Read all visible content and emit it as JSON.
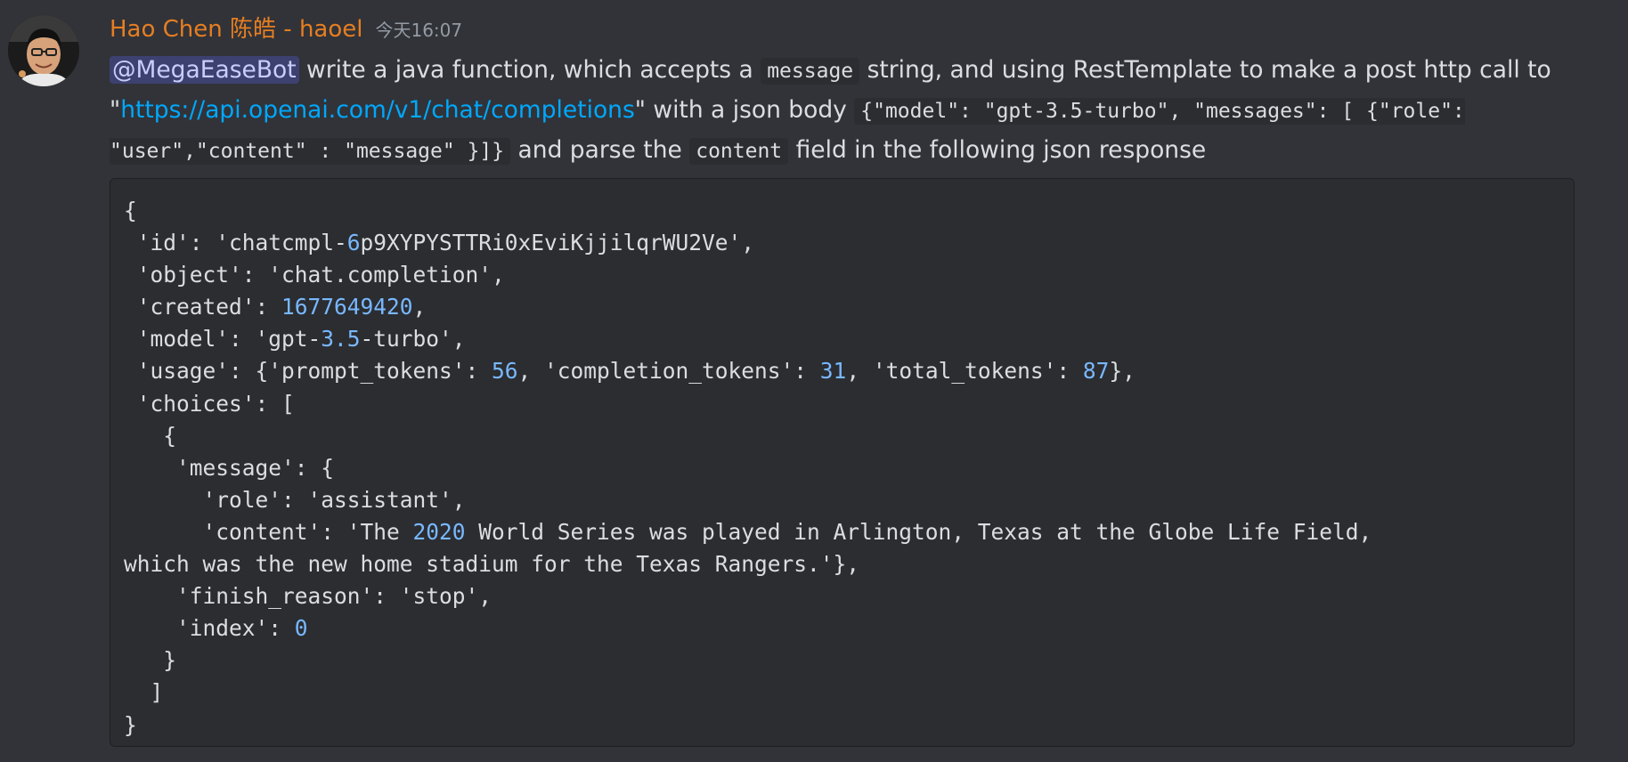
{
  "author": {
    "name": "Hao Chen 陈皓 - haoel",
    "timestamp": "今天16:07"
  },
  "message": {
    "mention": "@MegaEaseBot",
    "text_1": " write a java function, which accepts a ",
    "code_1": "message",
    "text_2": " string, and using RestTemplate to make a  post http  call to \"",
    "link": "https://api.openai.com/v1/chat/completions",
    "text_3": "\" with a json body ",
    "code_2": "{\"model\": \"gpt-3.5-turbo\", \"messages\": [  {\"role\": \"user\",\"content\" : \"message\"  }]}",
    "text_4": " and parse the ",
    "code_3": "content",
    "text_5": " field in the following json response"
  },
  "code_block": {
    "line_01": "{",
    "line_02_a": " 'id': 'chatcmpl-",
    "line_02_num": "6",
    "line_02_b": "p9XYPYSTTRi0xEviKjjilqrWU2Ve',",
    "line_03": " 'object': 'chat.completion',",
    "line_04_a": " 'created': ",
    "line_04_num": "1677649420",
    "line_04_b": ",",
    "line_05_a": " 'model': 'gpt-",
    "line_05_num": "3.5",
    "line_05_b": "-turbo',",
    "line_06_a": " 'usage': {'prompt_tokens': ",
    "line_06_num1": "56",
    "line_06_b": ", 'completion_tokens': ",
    "line_06_num2": "31",
    "line_06_c": ", 'total_tokens': ",
    "line_06_num3": "87",
    "line_06_d": "},",
    "line_07": " 'choices': [",
    "line_08": "   {",
    "line_09": "    'message': {",
    "line_10": "      'role': 'assistant',",
    "line_11_a": "      'content': 'The ",
    "line_11_num": "2020",
    "line_11_b": " World Series was played in Arlington, Texas at the Globe Life Field,",
    "line_12": "which was the new home stadium for the Texas Rangers.'},",
    "line_13": "    'finish_reason': 'stop',",
    "line_14_a": "    'index': ",
    "line_14_num": "0",
    "line_15": "   }",
    "line_16": "  ]",
    "line_17": "}"
  },
  "colors": {
    "background": "#313338",
    "username": "#e67e22",
    "link": "#00a8fc",
    "number": "#79b8ff"
  }
}
